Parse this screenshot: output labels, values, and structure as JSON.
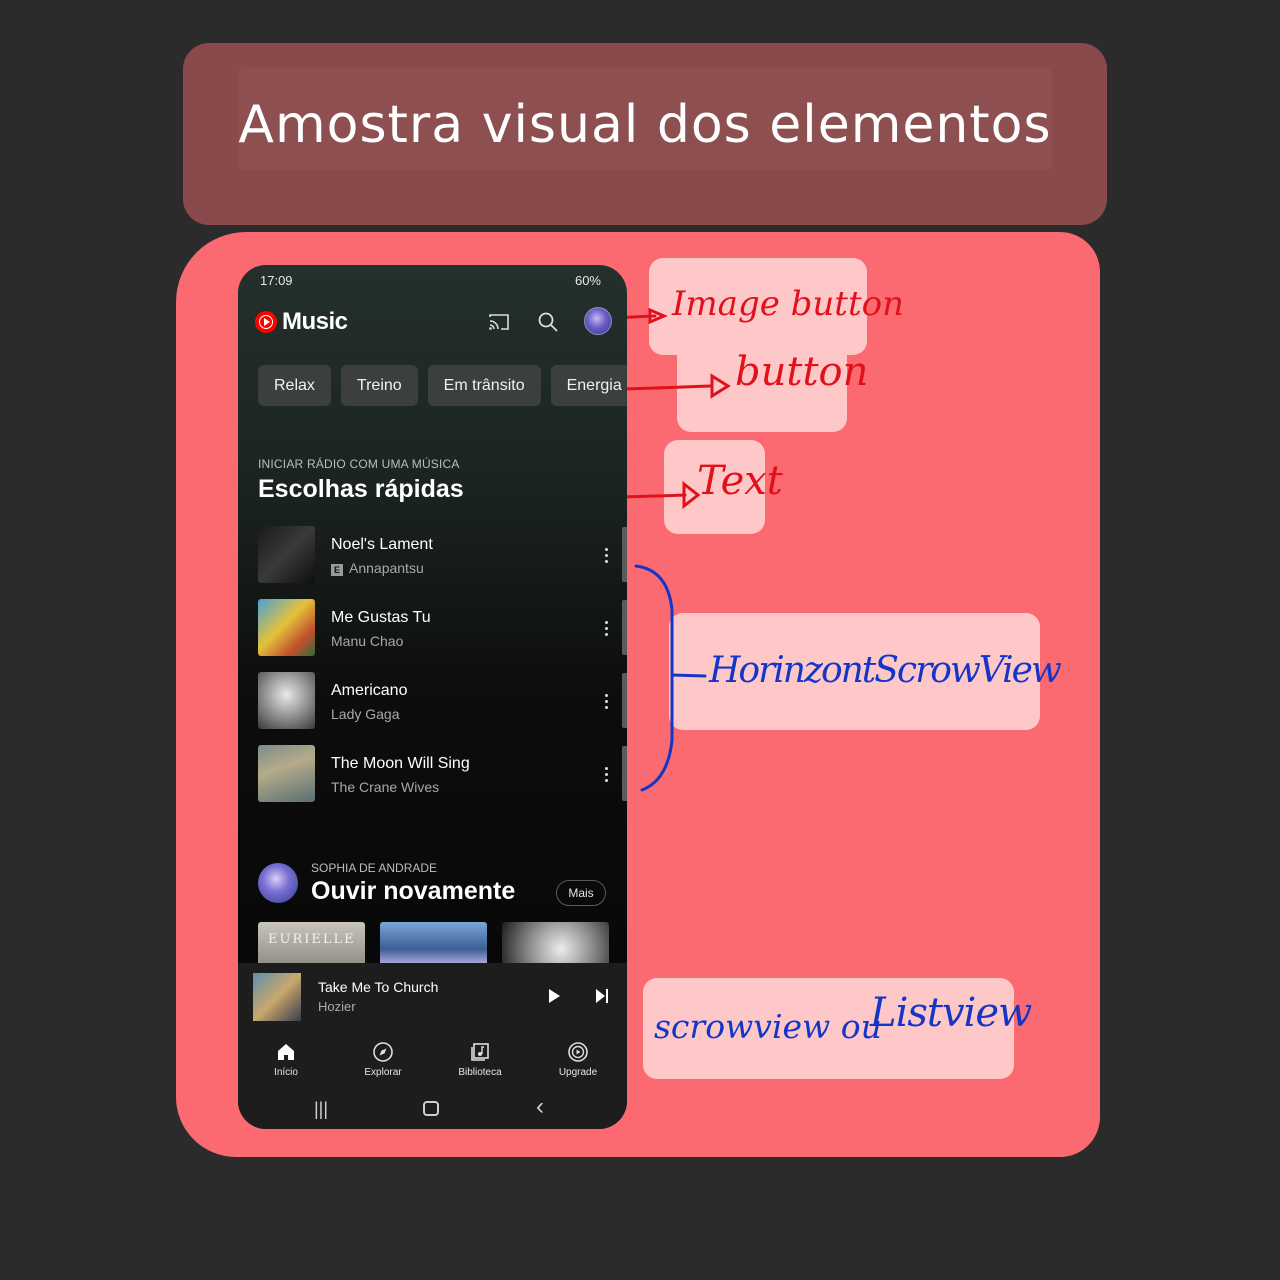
{
  "slide": {
    "title": "Amostra visual dos elementos"
  },
  "phone": {
    "status": {
      "time": "17:09",
      "battery": "60%"
    },
    "header": {
      "app_name": "Music"
    },
    "chips": [
      "Relax",
      "Treino",
      "Em trânsito",
      "Energia"
    ],
    "quick_picks": {
      "eyebrow": "INICIAR RÁDIO COM UMA MÚSICA",
      "title": "Escolhas rápidas",
      "songs": [
        {
          "title": "Noel's Lament",
          "artist": "Annapantsu",
          "explicit": "E"
        },
        {
          "title": "Me Gustas Tu",
          "artist": "Manu Chao"
        },
        {
          "title": "Americano",
          "artist": "Lady Gaga"
        },
        {
          "title": "The Moon Will Sing",
          "artist": "The Crane Wives"
        }
      ]
    },
    "listen_again": {
      "eyebrow": "SOPHIA DE ANDRADE",
      "title": "Ouvir novamente",
      "more_label": "Mais",
      "card1_text": "EURIELLE"
    },
    "mini_player": {
      "title": "Take Me To Church",
      "artist": "Hozier"
    },
    "nav": [
      "Início",
      "Explorar",
      "Biblioteca",
      "Upgrade"
    ],
    "system_nav": {
      "recents": "|||",
      "back": "‹"
    }
  },
  "annotations": {
    "image_button": "Image button",
    "button": "button",
    "text": "Text",
    "horizontal": "HorinzontScrowView",
    "list_a": "scrowview ou",
    "list_b": "Listview"
  },
  "colors": {
    "annotation_red": "#e0111b",
    "annotation_blue": "#1436c8",
    "board": "#fa6a70",
    "label_bg": "#ffc8c8"
  }
}
